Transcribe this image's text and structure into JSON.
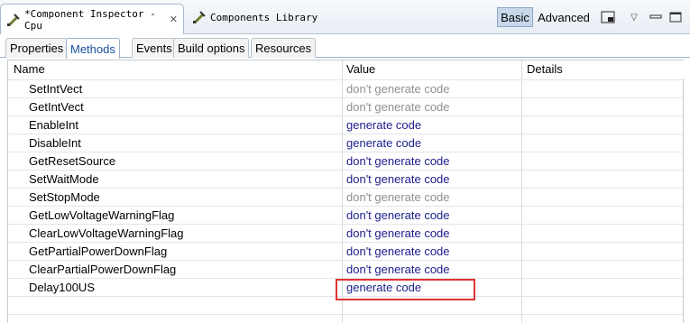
{
  "viewbar": {
    "active_tab": "*Component Inspector - Cpu",
    "inactive_tab": "Components Library",
    "basic": "Basic",
    "advanced": "Advanced"
  },
  "innertabs": [
    "Properties",
    "Methods",
    "Events",
    "Build options",
    "Resources"
  ],
  "table": {
    "columns": [
      "Name",
      "Value",
      "Details"
    ],
    "rows": [
      {
        "name": "SetIntVect",
        "value": "don't generate code",
        "style": "gray"
      },
      {
        "name": "GetIntVect",
        "value": "don't generate code",
        "style": "gray"
      },
      {
        "name": "EnableInt",
        "value": "generate code",
        "style": "blue"
      },
      {
        "name": "DisableInt",
        "value": "generate code",
        "style": "blue"
      },
      {
        "name": "GetResetSource",
        "value": "don't generate code",
        "style": "blue"
      },
      {
        "name": "SetWaitMode",
        "value": "don't generate code",
        "style": "blue"
      },
      {
        "name": "SetStopMode",
        "value": "don't generate code",
        "style": "gray"
      },
      {
        "name": "GetLowVoltageWarningFlag",
        "value": "don't generate code",
        "style": "blue"
      },
      {
        "name": "ClearLowVoltageWarningFlag",
        "value": "don't generate code",
        "style": "blue"
      },
      {
        "name": "GetPartialPowerDownFlag",
        "value": "don't generate code",
        "style": "blue"
      },
      {
        "name": "ClearPartialPowerDownFlag",
        "value": "don't generate code",
        "style": "blue"
      },
      {
        "name": "Delay100US",
        "value": "generate code",
        "style": "blue"
      }
    ]
  },
  "colors": {
    "gray_value": "#909090",
    "blue_value": "#1c1c8c",
    "highlight": "#e03434"
  }
}
